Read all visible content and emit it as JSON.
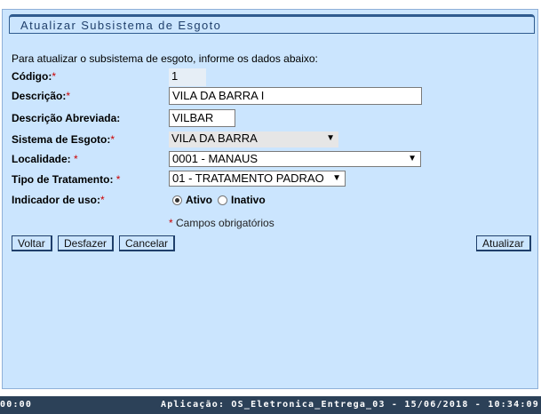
{
  "title": "Atualizar Subsistema de Esgoto",
  "intro": "Para atualizar o subsistema de esgoto, informe os dados abaixo:",
  "fields": {
    "codigo": {
      "label": "Código:",
      "value": "1"
    },
    "descricao": {
      "label": "Descrição:",
      "value": "VILA DA BARRA I"
    },
    "descricao_abreviada": {
      "label": "Descrição Abreviada:",
      "value": "VILBAR"
    },
    "sistema_esgoto": {
      "label": "Sistema de Esgoto:",
      "value": "VILA DA BARRA"
    },
    "localidade": {
      "label": "Localidade: ",
      "value": "0001 - MANAUS"
    },
    "tipo_tratamento": {
      "label": "Tipo de Tratamento: ",
      "value": "01 - TRATAMENTO PADRAO"
    },
    "indicador_uso": {
      "label": "Indicador de uso:",
      "options": [
        "Ativo",
        "Inativo"
      ],
      "selected": "Ativo"
    }
  },
  "required_marker": "*",
  "required_note": " Campos obrigatórios",
  "buttons": {
    "voltar": "Voltar",
    "desfazer": "Desfazer",
    "cancelar": "Cancelar",
    "atualizar": "Atualizar"
  },
  "status_bar": {
    "left": "00:00",
    "right": "Aplicação: OS_Eletronica_Entrega_03 - 15/06/2018 - 10:34:09"
  },
  "colors": {
    "panel_bg": "#cbe5fe",
    "border": "#1f3f6b",
    "required": "#cc0000",
    "status_bg": "#2c4158"
  }
}
